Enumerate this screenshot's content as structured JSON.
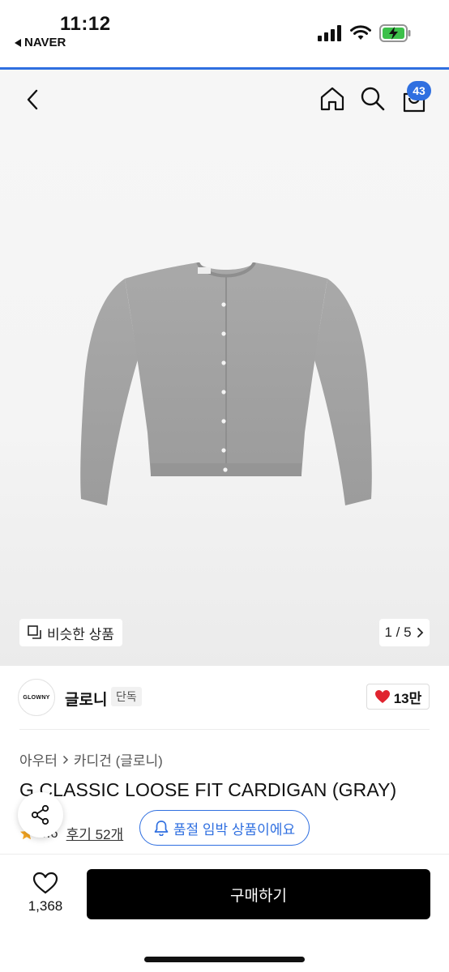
{
  "status_bar": {
    "time": "11:12",
    "back_app": "NAVER"
  },
  "nav": {
    "cart_count": "43"
  },
  "image": {
    "similar_label": "비슷한 상품",
    "pager": "1 / 5"
  },
  "brand": {
    "logo_text": "GLOWNY",
    "name": "글로니",
    "tag": "단독",
    "likes": "13만"
  },
  "breadcrumb": {
    "category": "아우터",
    "subcategory": "카디건 (글로니)"
  },
  "product": {
    "title": "G CLASSIC LOOSE FIT CARDIGAN (GRAY)",
    "rating": "4.6",
    "reviews": "후기 52개",
    "soldout_notice": "품절 임박 상품이에요"
  },
  "bottom": {
    "wish_count": "1,368",
    "buy_label": "구매하기"
  },
  "colors": {
    "accent": "#2f6fe0",
    "heart": "#e0242f",
    "star": "#f5a623"
  }
}
